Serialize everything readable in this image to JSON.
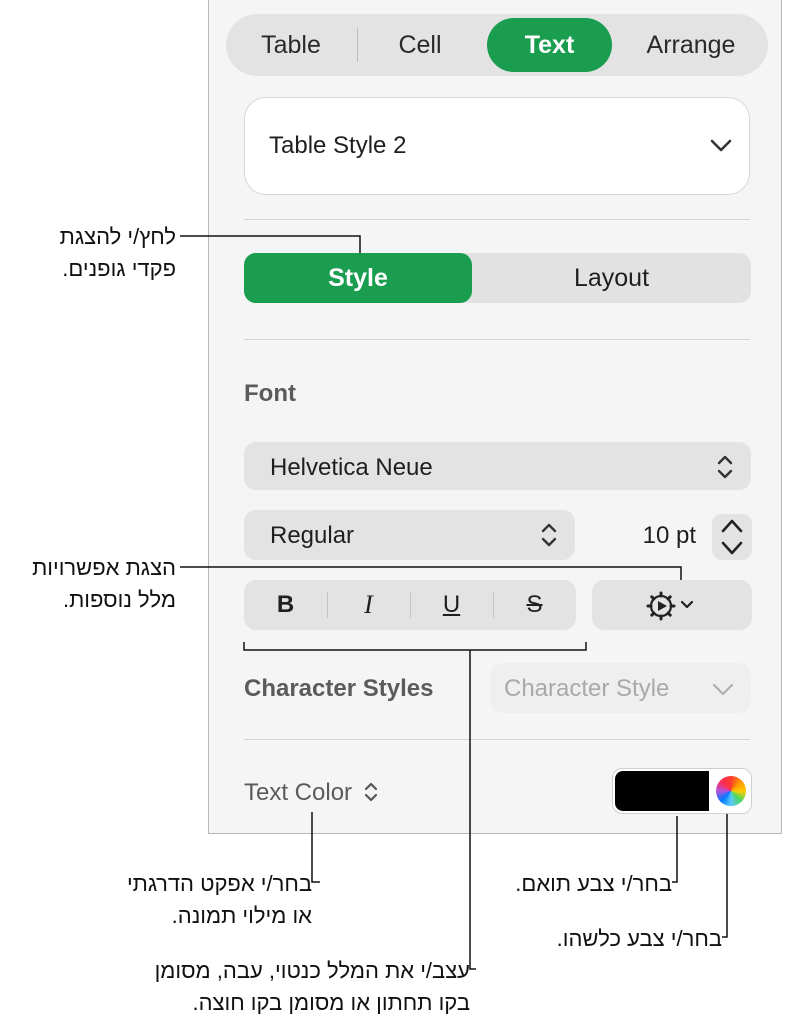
{
  "tabs": [
    {
      "label": "Table",
      "active": false
    },
    {
      "label": "Cell",
      "active": false
    },
    {
      "label": "Text",
      "active": true
    },
    {
      "label": "Arrange",
      "active": false
    }
  ],
  "table_style": {
    "value": "Table Style 2"
  },
  "segment": {
    "style": "Style",
    "layout": "Layout",
    "selected": "Style"
  },
  "font": {
    "section_label": "Font",
    "family": "Helvetica Neue",
    "typeface": "Regular",
    "size": "10 pt"
  },
  "format_buttons": {
    "bold": "B",
    "italic": "I",
    "underline": "U",
    "strike": "S"
  },
  "character_styles": {
    "label": "Character Styles",
    "placeholder": "Character Style"
  },
  "text_color": {
    "label": "Text Color",
    "swatch_color": "#000000"
  },
  "accent_color": "#1a9d4f",
  "callouts": {
    "style_tab_line1": "לחץ/י להצגת",
    "style_tab_line2": "פקדי גופנים.",
    "more_options_line1": "הצגת אפשרויות",
    "more_options_line2": "מלל נוספות.",
    "gradient_line1": "בחר/י אפקט הדרגתי",
    "gradient_line2": "או מילוי תמונה.",
    "format_line1": "עצב/י את המלל כנטוי, עבה, מסומן",
    "format_line2": "בקו תחתון או מסומן בקו חוצה.",
    "matching_color": "בחר/י צבע תואם.",
    "any_color": "בחר/י צבע כלשהו."
  }
}
